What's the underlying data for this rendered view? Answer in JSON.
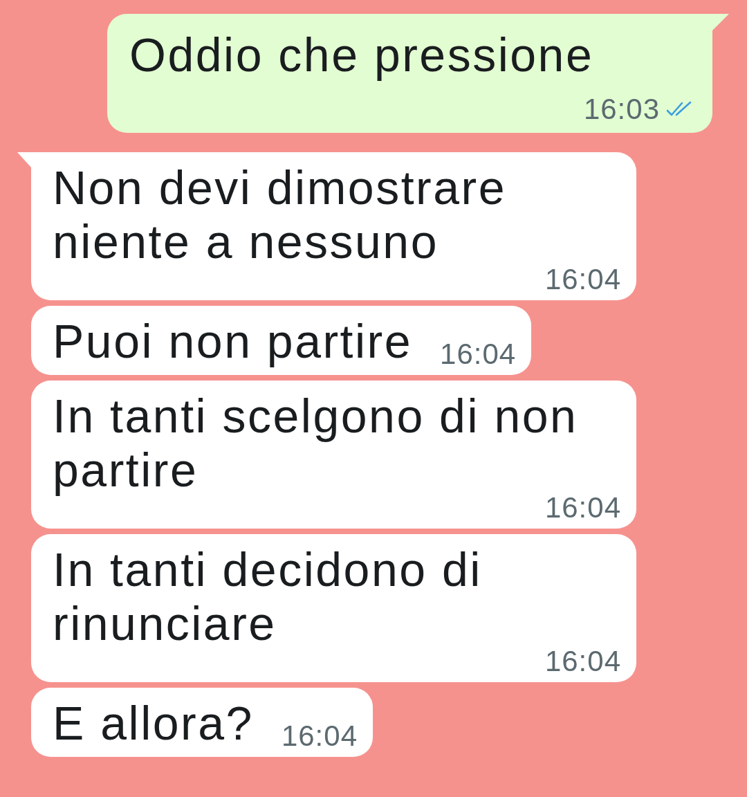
{
  "messages": [
    {
      "kind": "sent",
      "text": "Oddio che pressione",
      "time": "16:03",
      "read": true,
      "tail": true
    },
    {
      "kind": "received",
      "text": "Non devi dimostrare niente a nessuno",
      "time": "16:04",
      "tail": true
    },
    {
      "kind": "received",
      "text": "Puoi non partire",
      "time": "16:04",
      "tail": false
    },
    {
      "kind": "received",
      "text": "In tanti scelgono di non partire",
      "time": "16:04",
      "tail": false
    },
    {
      "kind": "received",
      "text": "In tanti decidono di rinunciare",
      "time": "16:04",
      "tail": false
    },
    {
      "kind": "received",
      "text": "E allora?",
      "time": "16:04",
      "tail": false
    }
  ]
}
